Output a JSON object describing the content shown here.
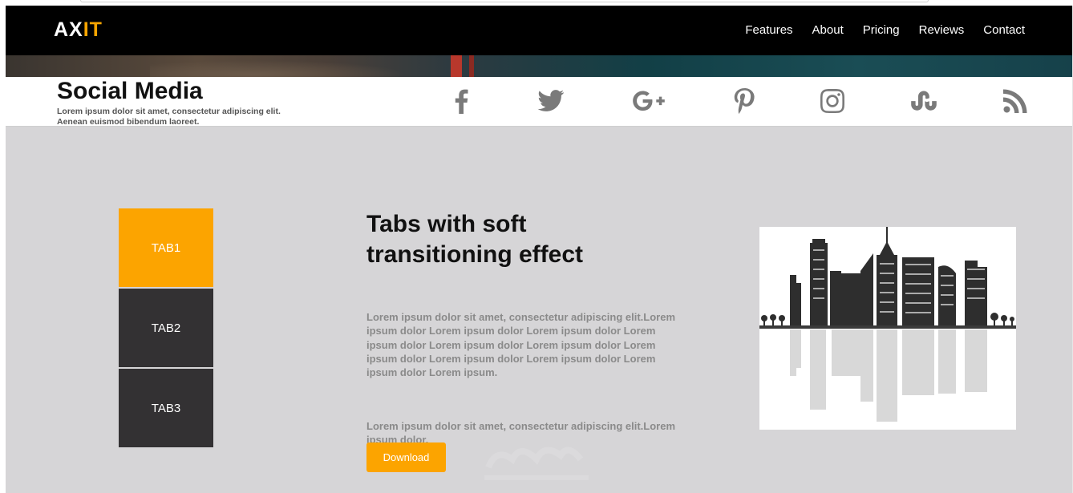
{
  "navbar": {
    "logo_main": "AX",
    "logo_accent": "IT",
    "links": [
      "Features",
      "About",
      "Pricing",
      "Reviews",
      "Contact"
    ]
  },
  "social": {
    "title": "Social Media",
    "subtitle_line1": "Lorem ipsum dolor sit amet, consectetur adipiscing elit.",
    "subtitle_line2": "Aenean euismod bibendum laoreet.",
    "icons": [
      "facebook-icon",
      "twitter-icon",
      "google-plus-icon",
      "pinterest-icon",
      "instagram-icon",
      "stumbleupon-icon",
      "rss-icon"
    ]
  },
  "tabs": {
    "items": [
      "TAB1",
      "TAB2",
      "TAB3"
    ],
    "active": "TAB1"
  },
  "content": {
    "heading": "Tabs with soft transitioning effect",
    "para1": "Lorem ipsum dolor sit amet, consectetur adipiscing elit.Lorem ipsum dolor Lorem ipsum dolor Lorem ipsum dolor Lorem ipsum dolor Lorem ipsum dolor Lorem ipsum dolor Lorem ipsum dolor Lorem ipsum dolor Lorem ipsum dolor Lorem ipsum dolor Lorem ipsum.",
    "para2": "Lorem ipsum dolor sit amet, consectetur adipiscing elit.Lorem ipsum dolor.",
    "download_label": "Download"
  },
  "colors": {
    "accent": "#fca400",
    "tab_inactive": "#333133",
    "section_bg": "#d6d5d7",
    "navbar_bg": "#000000"
  }
}
